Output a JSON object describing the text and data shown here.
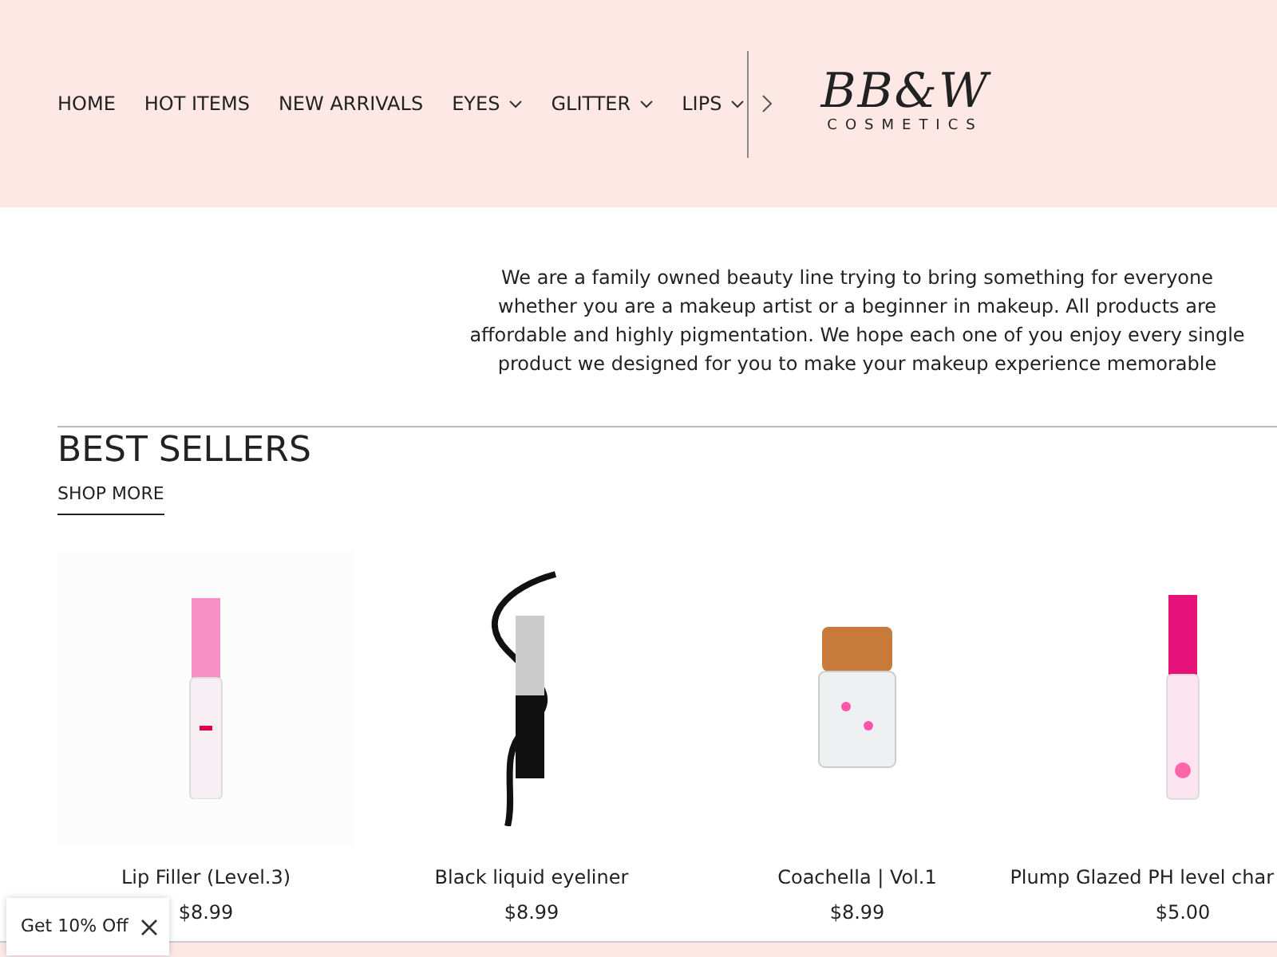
{
  "header": {
    "nav": [
      {
        "label": "HOME",
        "dropdown": false
      },
      {
        "label": "HOT ITEMS",
        "dropdown": false
      },
      {
        "label": "NEW ARRIVALS",
        "dropdown": false
      },
      {
        "label": "EYES",
        "dropdown": true
      },
      {
        "label": "GLITTER",
        "dropdown": true
      },
      {
        "label": "LIPS",
        "dropdown": true
      }
    ],
    "logo": {
      "script": "BB&W",
      "subtitle": "COSMETICS"
    }
  },
  "about": "We are a family owned beauty line trying to bring something for everyone whether you are a makeup artist or a beginner in makeup. All products are affordable and highly pigmentation. We hope each one of you enjoy every single product we designed for you to make your makeup experience memorable",
  "best_sellers": {
    "title": "BEST SELLERS",
    "link": "SHOP MORE",
    "products": [
      {
        "kind": "gloss",
        "name": "Lip Filler (Level.3)",
        "price": "$8.99"
      },
      {
        "kind": "eyeliner",
        "name": "Black liquid eyeliner",
        "price": "$8.99"
      },
      {
        "kind": "jar",
        "name": "Coachella | Vol.1",
        "price": "$8.99"
      },
      {
        "kind": "oil",
        "name": "Plump Glazed PH level char",
        "price": "$5.00"
      }
    ]
  },
  "popup": {
    "label": "Get 10% Off"
  }
}
